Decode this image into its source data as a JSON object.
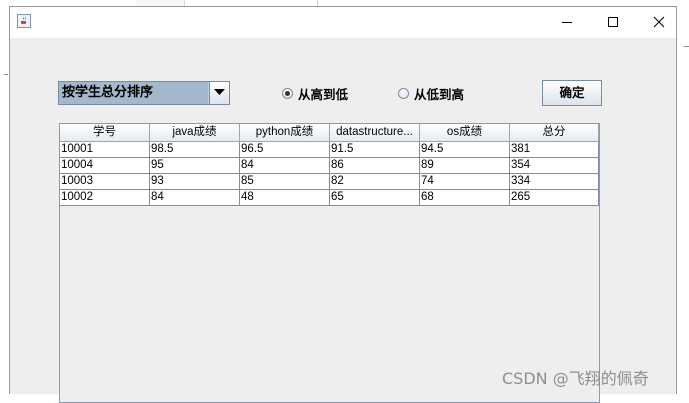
{
  "window": {
    "minimize_label": "minimize",
    "maximize_label": "maximize",
    "close_label": "close"
  },
  "controls": {
    "sort_select": {
      "selected": "按学生总分排序"
    },
    "radio_desc": {
      "label": "从高到低",
      "checked": true
    },
    "radio_asc": {
      "label": "从低到高",
      "checked": false
    },
    "confirm_label": "确定"
  },
  "table": {
    "headers": [
      "学号",
      "java成绩",
      "python成绩",
      "datastructure...",
      "os成绩",
      "总分"
    ],
    "rows": [
      [
        "10001",
        "98.5",
        "96.5",
        "91.5",
        "94.5",
        "381"
      ],
      [
        "10004",
        "95",
        "84",
        "86",
        "89",
        "354"
      ],
      [
        "10003",
        "93",
        "85",
        "82",
        "74",
        "334"
      ],
      [
        "10002",
        "84",
        "48",
        "65",
        "68",
        "265"
      ]
    ]
  },
  "watermark": "CSDN @飞翔的佩奇",
  "icons": {
    "app": "java-cup-icon",
    "dropdown": "chevron-down-icon",
    "minimize": "minimize-icon",
    "maximize": "maximize-icon",
    "close": "close-icon"
  },
  "colors": {
    "window_bg": "#eeeeee",
    "combo_bg": "#a3b8cc",
    "title_bg": "#ffffff"
  }
}
